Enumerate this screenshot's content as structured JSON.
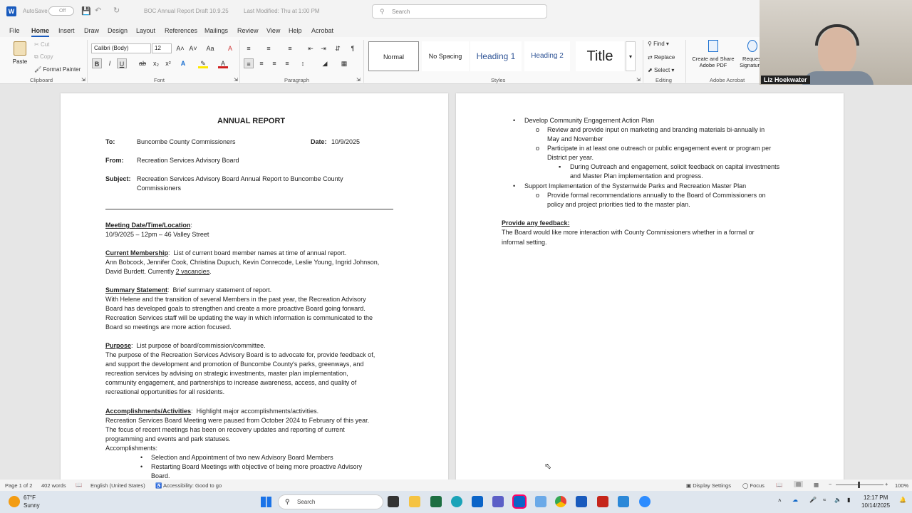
{
  "titlebar": {
    "autosave_label": "AutoSave",
    "autosave_state": "Off",
    "doc_title": "BOC Annual Report Draft 10.9.25",
    "modified": "Last Modified: Thu at 1:00 PM",
    "search_placeholder": "Search"
  },
  "menu": [
    "File",
    "Home",
    "Insert",
    "Draw",
    "Design",
    "Layout",
    "References",
    "Mailings",
    "Review",
    "View",
    "Help",
    "Acrobat"
  ],
  "ribbon": {
    "paste": "Paste",
    "cut": "Cut",
    "copy": "Copy",
    "format_painter": "Format Painter",
    "clipboard": "Clipboard",
    "font_name": "Calibri (Body)",
    "font_size": "12",
    "font": "Font",
    "paragraph": "Paragraph",
    "styles": [
      "Normal",
      "No Spacing",
      "Heading 1",
      "Heading 2",
      "Title"
    ],
    "styles_label": "Styles",
    "find": "Find",
    "replace": "Replace",
    "select": "Select",
    "editing": "Editing",
    "create_share": "Create and Share",
    "adobe_pdf": "Adobe PDF",
    "request": "Request",
    "signatures": "Signatures",
    "adobe_acrobat": "Adobe Acrobat"
  },
  "webcam": {
    "name": "Liz Hoekwater"
  },
  "page1": {
    "title": "ANNUAL REPORT",
    "to_label": "To:",
    "to_value": "Buncombe County Commissioners",
    "date_label": "Date:",
    "date_value": "10/9/2025",
    "from_label": "From:",
    "from_value": "Recreation Services Advisory Board",
    "subject_label": "Subject:",
    "subject_line1": "Recreation Services Advisory Board Annual Report to Buncombe County",
    "subject_line2": "Commissioners",
    "meeting_heading": "Meeting Date/Time/Location",
    "meeting_value": "10/9/2025 – 12pm – 46 Valley Street",
    "membership_heading": "Current Membership",
    "membership_desc": "List of current board member names at time of annual report.",
    "membership_line1": "Ann Bobcock, Jennifer Cook, Christina Dupuch, Kevin Conrecode, Leslie Young, Ingrid Johnson,",
    "membership_line2a": "David Burdett. Currently",
    "membership_vacancies": "2 vacancies",
    "summary_heading": "Summary Statement",
    "summary_desc": "Brief summary statement of report.",
    "summary_lines": [
      "With Helene and the transition of several Members in the past year, the Recreation Advisory",
      "Board has developed goals to strengthen and create a more proactive Board going forward.",
      "Recreation Services staff will be updating the way in which information is communicated to the",
      "Board so meetings are more action focused."
    ],
    "purpose_heading": "Purpose",
    "purpose_desc": "List purpose of board/commission/committee.",
    "purpose_lines": [
      "The purpose of the Recreation Services Advisory Board is to advocate for, provide feedback of,",
      "and support the development and promotion of Buncombe County's parks, greenways, and",
      "recreation services by advising on strategic investments, master plan implementation,",
      "community engagement, and partnerships to increase awareness, access, and quality of",
      "recreational opportunities for all residents."
    ],
    "accomplishments_heading": "Accomplishments/Activities",
    "accomplishments_desc": "Highlight major accomplishments/activities.",
    "accomplishments_lines": [
      "Recreation Services Board Meeting were paused from October 2024 to February of this year.",
      "The focus of recent meetings has been on recovery updates and reporting of current",
      "programming and events and park statuses.",
      "Accomplishments:"
    ],
    "bullets": [
      "Selection and Appointment of two new Advisory Board Members",
      "Restarting Board Meetings with objective of being more proactive Advisory",
      "Board."
    ]
  },
  "page2": {
    "b1": "Develop Community Engagement Action Plan",
    "b1_sub1_l1": "Review and provide input on marketing and branding materials bi-annually in",
    "b1_sub1_l2": "May and November",
    "b1_sub2_l1": "Participate in at least one outreach or public engagement event or program per",
    "b1_sub2_l2": "District per year.",
    "b1_sub2_sub_l1": "During Outreach and engagement, solicit feedback on capital investments",
    "b1_sub2_sub_l2": "and Master Plan implementation and progress.",
    "b2": "Support Implementation of the Systemwide Parks and Recreation Master Plan",
    "b2_sub1_l1": "Provide formal recommendations annually to the Board of Commissioners on",
    "b2_sub1_l2": "policy and project priorities tied to the master plan.",
    "feedback_heading": "Provide any feedback:",
    "feedback_l1": "The Board would like more interaction with County Commissioners whether in a formal or",
    "feedback_l2": "informal setting."
  },
  "status": {
    "page": "Page 1 of 2",
    "words": "402 words",
    "language": "English (United States)",
    "accessibility": "Accessibility: Good to go",
    "display_settings": "Display Settings",
    "focus": "Focus",
    "zoom": "100%"
  },
  "taskbar": {
    "temp": "67°F",
    "weather": "Sunny",
    "search": "Search",
    "time": "12:17 PM",
    "date": "10/14/2025"
  }
}
